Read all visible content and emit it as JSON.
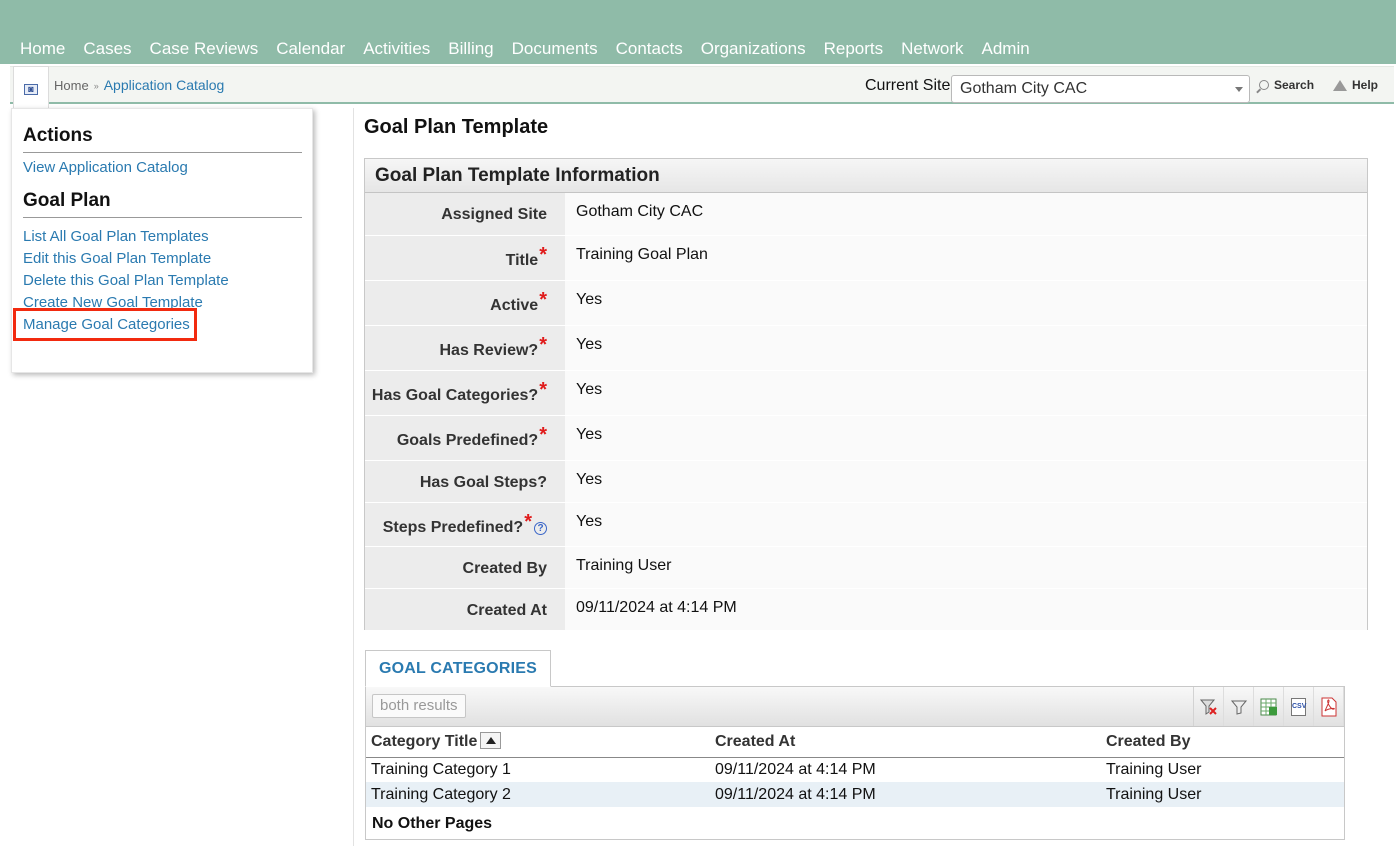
{
  "nav": [
    "Home",
    "Cases",
    "Case Reviews",
    "Calendar",
    "Activities",
    "Billing",
    "Documents",
    "Contacts",
    "Organizations",
    "Reports",
    "Network",
    "Admin"
  ],
  "breadcrumb": {
    "home": "Home",
    "separator": "»",
    "current": "Application Catalog"
  },
  "site": {
    "label": "Current Site",
    "value": "Gotham City CAC"
  },
  "tools": {
    "search": "Search",
    "help": "Help"
  },
  "sidebar": {
    "actions_heading": "Actions",
    "actions": [
      "View Application Catalog"
    ],
    "goal_plan_heading": "Goal Plan",
    "goal_plan_links": [
      "List All Goal Plan Templates",
      "Edit this Goal Plan Template",
      "Delete this Goal Plan Template",
      "Create New Goal Template",
      "Manage Goal Categories"
    ]
  },
  "page": {
    "title": "Goal Plan Template"
  },
  "info": {
    "heading": "Goal Plan Template Information",
    "fields": [
      {
        "label": "Assigned Site",
        "value": "Gotham City CAC"
      },
      {
        "label": "Title",
        "value": "Training Goal Plan"
      },
      {
        "label": "Active",
        "value": "Yes"
      },
      {
        "label": "Has Review?",
        "value": "Yes"
      },
      {
        "label": "Has Goal Categories?",
        "value": "Yes"
      },
      {
        "label": "Goals Predefined?",
        "value": "Yes"
      },
      {
        "label": "Has Goal Steps?",
        "value": "Yes"
      },
      {
        "label": "Steps Predefined?",
        "value": "Yes"
      },
      {
        "label": "Created By",
        "value": "Training User"
      },
      {
        "label": "Created At",
        "value": "09/11/2024 at 4:14 PM"
      }
    ],
    "required_mark": "*"
  },
  "categories": {
    "tab_label": "GOAL CATEGORIES",
    "results_button": "both results",
    "export_icons": [
      "clear-filter-icon",
      "filter-icon",
      "excel-icon",
      "csv-icon",
      "pdf-icon"
    ],
    "csv_text": "CSV",
    "columns": [
      "Category Title",
      "Created At",
      "Created By"
    ],
    "rows": [
      [
        "Training Category 1",
        "09/11/2024 at 4:14 PM",
        "Training User"
      ],
      [
        "Training Category 2",
        "09/11/2024 at 4:14 PM",
        "Training User"
      ]
    ],
    "footer": "No Other Pages"
  },
  "colors": {
    "nav_bg": "#8fbba8",
    "link": "#2a7ab0",
    "required": "#e01b1b",
    "highlight": "#f22a0f"
  }
}
